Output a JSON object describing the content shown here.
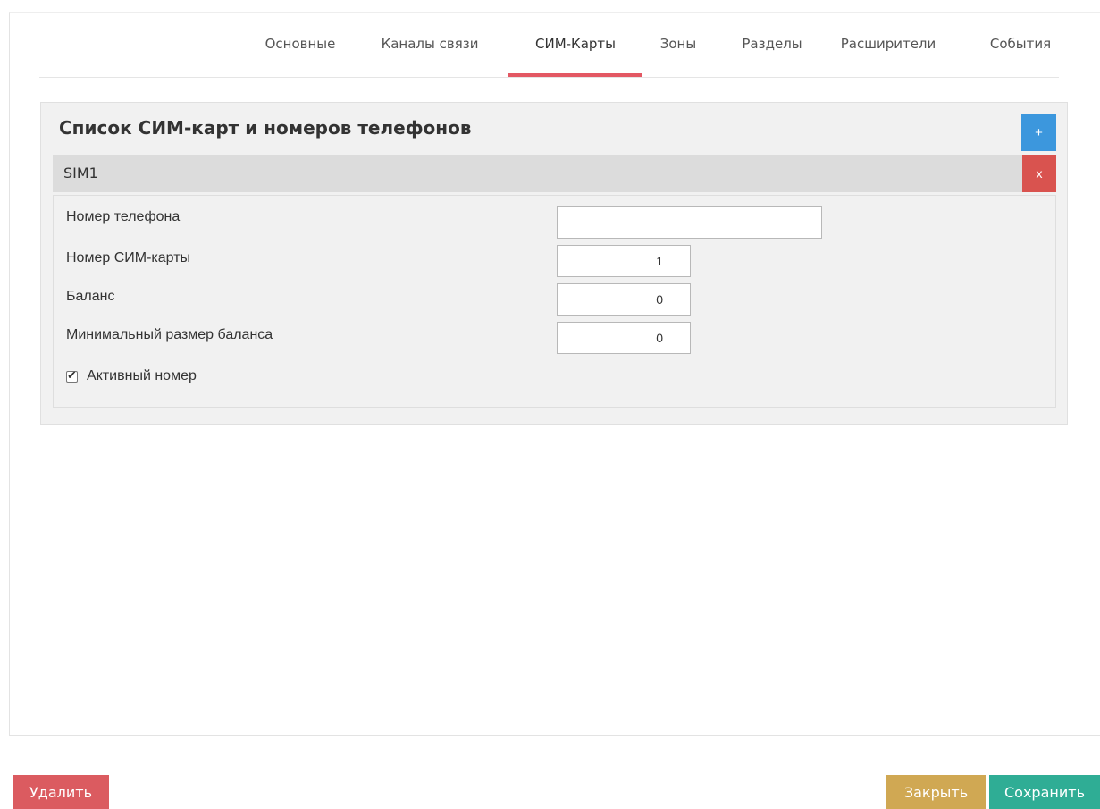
{
  "tabs": [
    {
      "label": "Основные",
      "active": false
    },
    {
      "label": "Каналы связи",
      "active": false
    },
    {
      "label": "СИМ-Карты",
      "active": true
    },
    {
      "label": "Зоны",
      "active": false
    },
    {
      "label": "Разделы",
      "active": false
    },
    {
      "label": "Расширители",
      "active": false
    },
    {
      "label": "События",
      "active": false
    }
  ],
  "panel": {
    "title": "Список СИМ-карт и номеров телефонов",
    "add_label": "+",
    "sim": {
      "name": "SIM1",
      "remove_label": "x",
      "fields": {
        "phone": {
          "label": "Номер телефона",
          "value": ""
        },
        "sim_number": {
          "label": "Номер СИМ-карты",
          "value": "1"
        },
        "balance": {
          "label": "Баланс",
          "value": "0"
        },
        "min_balance": {
          "label": "Минимальный размер баланса",
          "value": "0"
        }
      },
      "active": {
        "label": "Активный номер",
        "checked": true
      }
    }
  },
  "footer": {
    "delete_label": "Удалить",
    "close_label": "Закрыть",
    "save_label": "Сохранить"
  },
  "colors": {
    "active_tab_underline": "#e35863",
    "add_button": "#3c97dd",
    "remove_button": "#d9534f",
    "delete_button": "#db5b60",
    "close_button": "#d0a853",
    "save_button": "#2fad95"
  }
}
